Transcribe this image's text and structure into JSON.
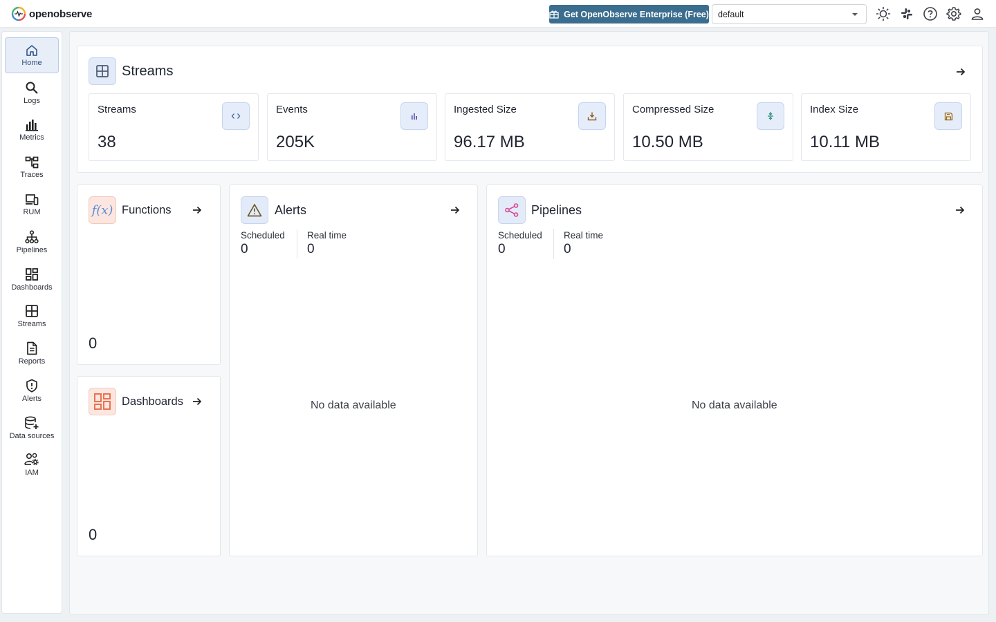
{
  "header": {
    "app_name": "openobserve",
    "enterprise_label": "Get OpenObserve Enterprise (Free)",
    "org_value": "default",
    "icons": [
      "theme-toggle-icon",
      "slack-icon",
      "help-icon",
      "settings-icon",
      "user-icon"
    ]
  },
  "sidebar": {
    "items": [
      {
        "label": "Home",
        "icon": "home-icon",
        "active": true
      },
      {
        "label": "Logs",
        "icon": "search-icon"
      },
      {
        "label": "Metrics",
        "icon": "bar-chart-icon"
      },
      {
        "label": "Traces",
        "icon": "traces-icon"
      },
      {
        "label": "RUM",
        "icon": "devices-icon"
      },
      {
        "label": "Pipelines",
        "icon": "pipeline-icon"
      },
      {
        "label": "Dashboards",
        "icon": "dashboard-icon"
      },
      {
        "label": "Streams",
        "icon": "grid-icon"
      },
      {
        "label": "Reports",
        "icon": "document-icon"
      },
      {
        "label": "Alerts",
        "icon": "shield-alert-icon"
      },
      {
        "label": "Data sources",
        "icon": "database-add-icon"
      },
      {
        "label": "IAM",
        "icon": "users-gear-icon"
      }
    ]
  },
  "streams_section": {
    "title": "Streams",
    "stats": [
      {
        "label": "Streams",
        "value": "38",
        "icon": "code-icon"
      },
      {
        "label": "Events",
        "value": "205K",
        "icon": "bar-chart-icon"
      },
      {
        "label": "Ingested Size",
        "value": "96.17 MB",
        "icon": "download-tray-icon"
      },
      {
        "label": "Compressed Size",
        "value": "10.50 MB",
        "icon": "compress-icon"
      },
      {
        "label": "Index Size",
        "value": "10.11 MB",
        "icon": "save-icon"
      }
    ]
  },
  "functions": {
    "title": "Functions",
    "count": "0"
  },
  "dashboards": {
    "title": "Dashboards",
    "count": "0"
  },
  "alerts": {
    "title": "Alerts",
    "scheduled_label": "Scheduled",
    "scheduled_value": "0",
    "realtime_label": "Real time",
    "realtime_value": "0",
    "empty_text": "No data available"
  },
  "pipelines": {
    "title": "Pipelines",
    "scheduled_label": "Scheduled",
    "scheduled_value": "0",
    "realtime_label": "Real time",
    "realtime_value": "0",
    "empty_text": "No data available"
  },
  "colors": {
    "accent": "#3a6d8e",
    "active_nav": "#e7eef8",
    "icon_tint": "#e6edfa"
  }
}
